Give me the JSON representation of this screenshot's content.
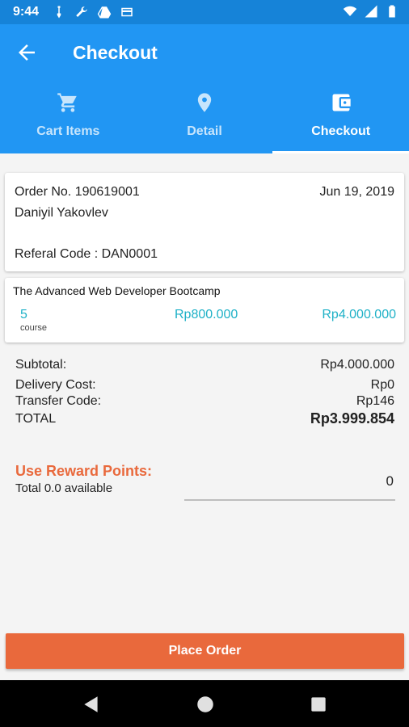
{
  "status_bar": {
    "time": "9:44",
    "left_icons": [
      "usb-icon",
      "wrench-icon",
      "drive-icon",
      "card-icon"
    ],
    "right_icons": [
      "wifi-icon",
      "signal-icon",
      "battery-icon"
    ]
  },
  "app_bar": {
    "title": "Checkout",
    "back_icon": "arrow-left-icon"
  },
  "tabs": [
    {
      "label": "Cart Items",
      "icon": "cart-icon",
      "active": false
    },
    {
      "label": "Detail",
      "icon": "location-pin-icon",
      "active": false
    },
    {
      "label": "Checkout",
      "icon": "wallet-icon",
      "active": true
    }
  ],
  "order": {
    "order_no": "Order No. 190619001",
    "date": "Jun 19, 2019",
    "customer": "Daniyil Yakovlev",
    "referal": "Referal Code : DAN0001"
  },
  "item": {
    "title": "The Advanced Web Developer Bootcamp",
    "quantity": "5",
    "unit": "course",
    "price": "Rp800.000",
    "line_total": "Rp4.000.000"
  },
  "summary": {
    "subtotal_label": "Subtotal:",
    "subtotal_value": "Rp4.000.000",
    "delivery_label": "Delivery Cost:",
    "delivery_value": "Rp0",
    "transfer_label": "Transfer Code:",
    "transfer_value": "Rp146",
    "total_label": "TOTAL",
    "total_value": "Rp3.999.854"
  },
  "reward": {
    "title": "Use Reward Points:",
    "available": "Total 0.0 available",
    "input_value": "0"
  },
  "actions": {
    "place_order": "Place Order"
  },
  "colors": {
    "primary": "#2196f3",
    "primary_dark": "#1683d8",
    "accent": "#e9693c",
    "price_teal": "#1fb1c7"
  }
}
